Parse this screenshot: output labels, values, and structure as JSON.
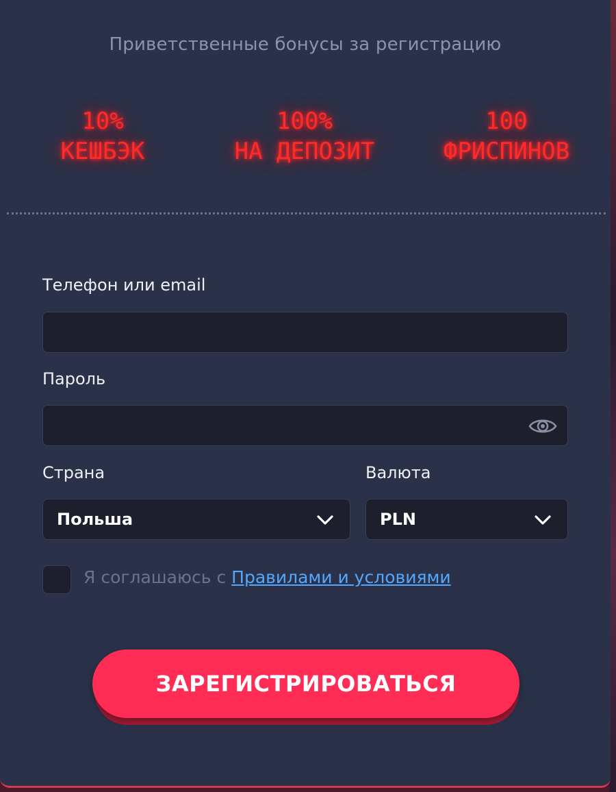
{
  "form": {
    "subtitle": "Приветственные бонусы за регистрацию",
    "bonuses": [
      {
        "line1": "10%",
        "line2": "КЕШБЭК"
      },
      {
        "line1": "100%",
        "line2": "НА ДЕПОЗИТ"
      },
      {
        "line1": "100",
        "line2": "ФРИСПИНОВ"
      }
    ],
    "login_label": "Телефон или email",
    "login_value": "",
    "password_label": "Пароль",
    "password_value": "",
    "country_label": "Страна",
    "country_value": "Польша",
    "currency_label": "Валюта",
    "currency_value": "PLN",
    "agree_prefix": "Я соглашаюсь с ",
    "agree_link": "Правилами и условиями",
    "agree_checked": false,
    "register_label": "ЗАРЕГИСТРИРОВАТЬСЯ"
  },
  "icons": {
    "password_toggle": "eye-icon",
    "dropdown": "chevron-down-icon"
  },
  "colors": {
    "panel_bg": "#2b3148",
    "input_bg": "#1d1f2c",
    "neon_red": "#ff2a2a",
    "button": "#ff2d55",
    "link": "#52a8ff"
  }
}
